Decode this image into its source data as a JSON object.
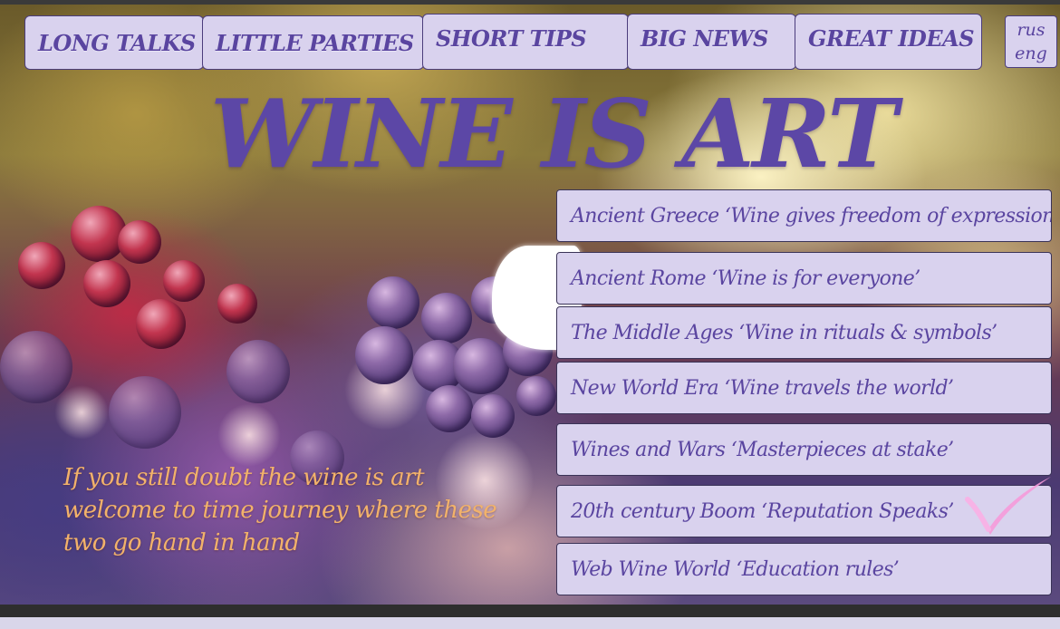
{
  "nav": {
    "tabs": [
      {
        "label": "LONG TALKS"
      },
      {
        "label": "LITTLE PARTIES"
      },
      {
        "label": "SHORT TIPS"
      },
      {
        "label": "BIG NEWS"
      },
      {
        "label": "GREAT IDEAS"
      }
    ],
    "languages": [
      "rus",
      "eng"
    ]
  },
  "hero": {
    "title": "WINE IS ART"
  },
  "eras": [
    {
      "label": "Ancient Greece ‘Wine gives freedom of expression’"
    },
    {
      "label": "Ancient Rome  ‘Wine is for everyone’"
    },
    {
      "label": "The Middle Ages ‘Wine in rituals & symbols’"
    },
    {
      "label": "New World Era ‘Wine travels the world’"
    },
    {
      "label": "Wines and Wars ‘Masterpieces at stake’"
    },
    {
      "label": "20th century Boom ‘Reputation Speaks’"
    },
    {
      "label": "Web Wine World ‘Education rules’"
    }
  ],
  "tagline": {
    "lines": [
      "If you still doubt the wine is art",
      "welcome to time journey where these",
      "two go hand in hand"
    ]
  },
  "colors": {
    "accent": "#5a45a0",
    "tab_bg": "#d9d2ee",
    "tagline": "#f2b26a",
    "check": "#f59ad9"
  },
  "icons": {
    "check": "checkmark-icon"
  }
}
